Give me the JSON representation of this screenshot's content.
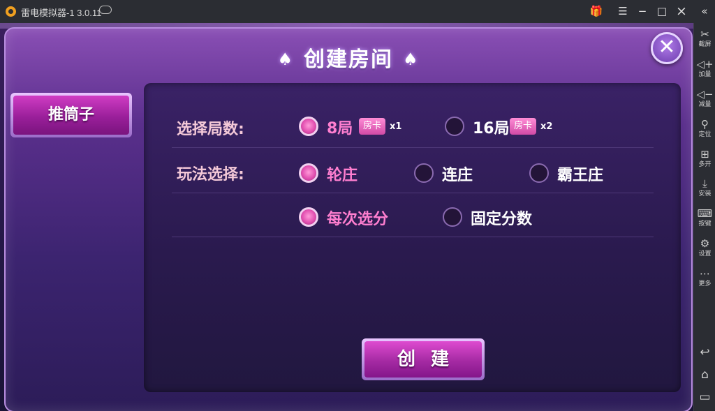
{
  "window": {
    "title": "雷电模拟器-1 3.0.11"
  },
  "titlebar_buttons": {
    "menu": "☰",
    "minimize": "−",
    "maximize": "□",
    "close": "×",
    "collapse": "«"
  },
  "sidebar": {
    "items": [
      {
        "icon": "scissors-icon",
        "glyph": "✂",
        "label": "截屏"
      },
      {
        "icon": "volume-up-icon",
        "glyph": "◁+",
        "label": "加量"
      },
      {
        "icon": "volume-down-icon",
        "glyph": "◁−",
        "label": "减量"
      },
      {
        "icon": "location-pin-icon",
        "glyph": "⚲",
        "label": "定位"
      },
      {
        "icon": "multi-open-icon",
        "glyph": "⊞",
        "label": "多开"
      },
      {
        "icon": "install-apk-icon",
        "glyph": "⤓",
        "label": "安装"
      },
      {
        "icon": "keyboard-icon",
        "glyph": "⌨",
        "label": "按键"
      },
      {
        "icon": "settings-icon",
        "glyph": "⚙",
        "label": "设置"
      },
      {
        "icon": "more-icon",
        "glyph": "⋯",
        "label": "更多"
      }
    ],
    "nav": {
      "back": "↩",
      "home": "⌂",
      "recent": "▭"
    }
  },
  "dialog": {
    "title": "创建房间",
    "spade": "♠",
    "close_glyph": "✕"
  },
  "side_tab": {
    "label": "推筒子"
  },
  "rounds": {
    "label": "选择局数:",
    "options": [
      {
        "text": "8局",
        "badge": "房卡",
        "mult": "x1",
        "selected": true
      },
      {
        "text": "16局",
        "badge": "房卡",
        "mult": "x2",
        "selected": false
      }
    ]
  },
  "mode": {
    "label": "玩法选择:",
    "options": [
      {
        "text": "轮庄",
        "selected": true
      },
      {
        "text": "连庄",
        "selected": false
      },
      {
        "text": "霸王庄",
        "selected": false
      }
    ]
  },
  "scoring": {
    "options": [
      {
        "text": "每次选分",
        "selected": true
      },
      {
        "text": "固定分数",
        "selected": false
      }
    ]
  },
  "create_button": {
    "label": "创建"
  }
}
